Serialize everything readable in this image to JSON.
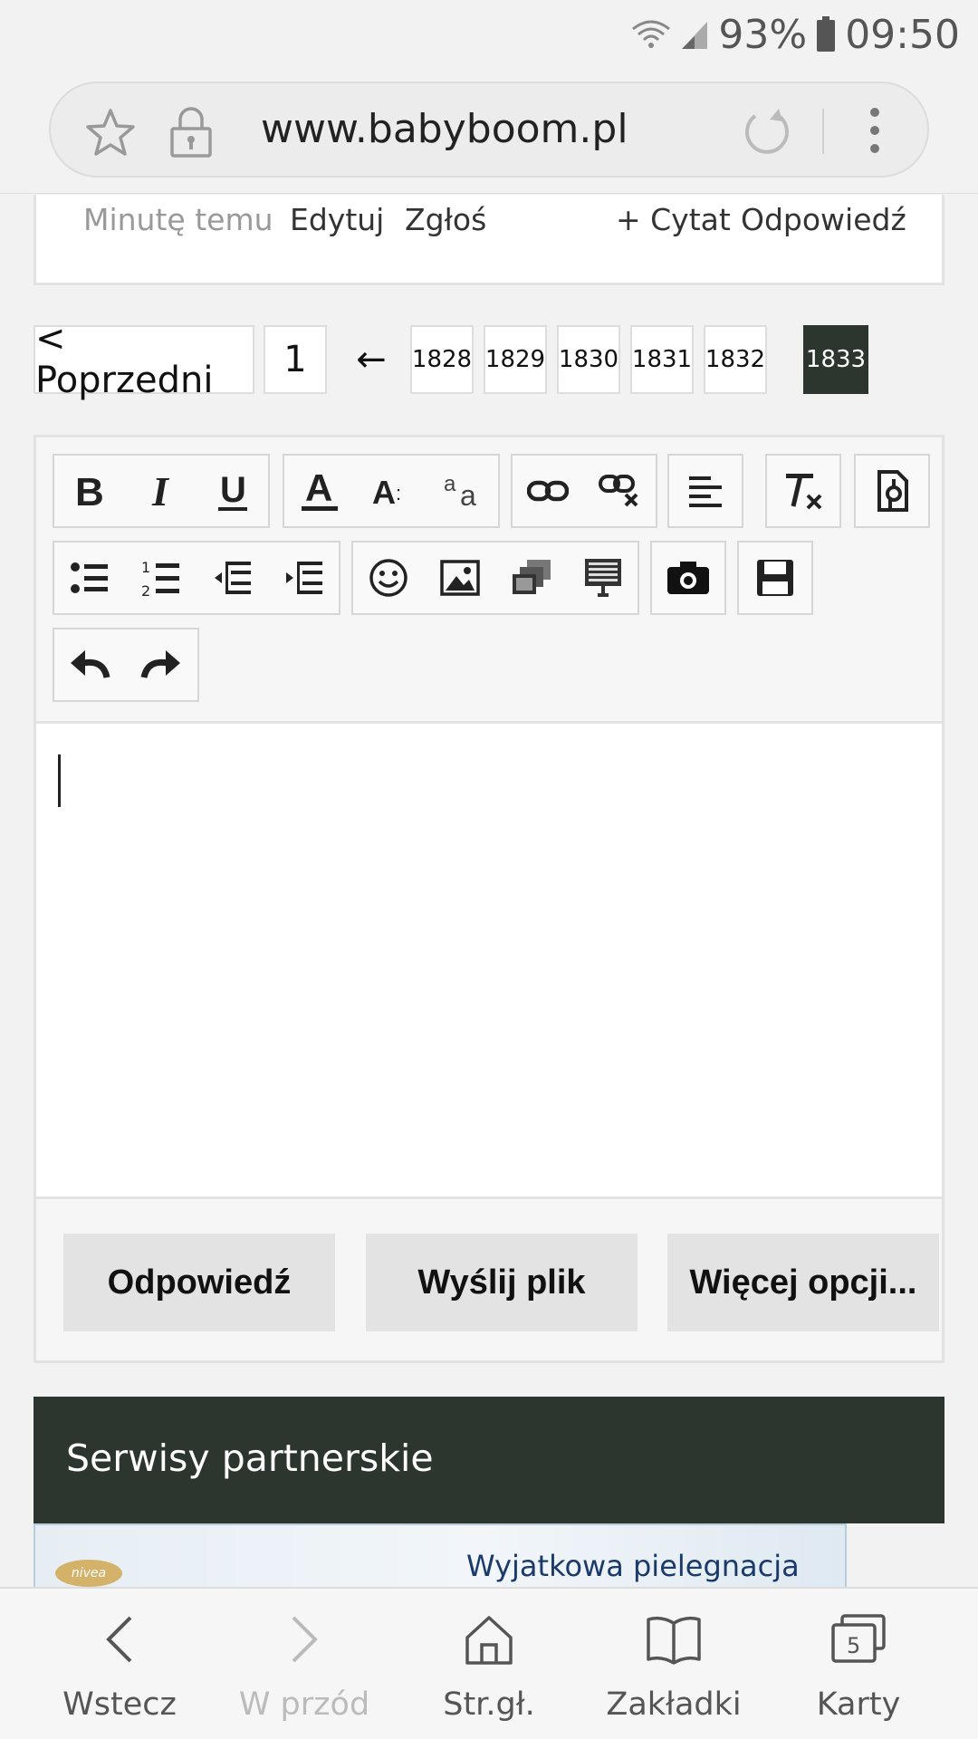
{
  "status_bar": {
    "battery": "93%",
    "time": "09:50"
  },
  "browser": {
    "url": "www.babyboom.pl"
  },
  "post_actions": {
    "time": "Minutę temu",
    "edit": "Edytuj",
    "report": "Zgłoś",
    "quote": "+ Cytat",
    "reply": "Odpowiedź"
  },
  "pagination": {
    "prev": "< Poprzedni",
    "first": "1",
    "arrow": "←",
    "pages": [
      "1828",
      "1829",
      "1830",
      "1831",
      "1832"
    ],
    "current": "1833"
  },
  "editor": {
    "toolbar_icons": [
      "bold-icon",
      "italic-icon",
      "underline-icon",
      "text-color-icon",
      "font-size-icon",
      "case-icon",
      "link-icon",
      "unlink-icon",
      "align-icon",
      "clear-format-icon",
      "source-icon",
      "bullet-list-icon",
      "numbered-list-icon",
      "outdent-icon",
      "indent-icon",
      "emoji-icon",
      "image-icon",
      "gallery-icon",
      "template-icon",
      "camera-icon",
      "save-icon",
      "undo-icon",
      "redo-icon"
    ],
    "actions": {
      "reply": "Odpowiedź",
      "upload": "Wyślij plik",
      "more": "Więcej opcji..."
    }
  },
  "partners": {
    "title": "Serwisy partnerskie",
    "banner_text": "Wyjatkowa pielegnacja",
    "banner_logo": "nivea"
  },
  "bottom_nav": {
    "back": "Wstecz",
    "forward": "W przód",
    "home": "Str.gł.",
    "bookmarks": "Zakładki",
    "tabs": "Karty",
    "tabs_count": "5"
  },
  "colors": {
    "accent_dark": "#2c362e",
    "page_bg": "#f2f2f2"
  }
}
